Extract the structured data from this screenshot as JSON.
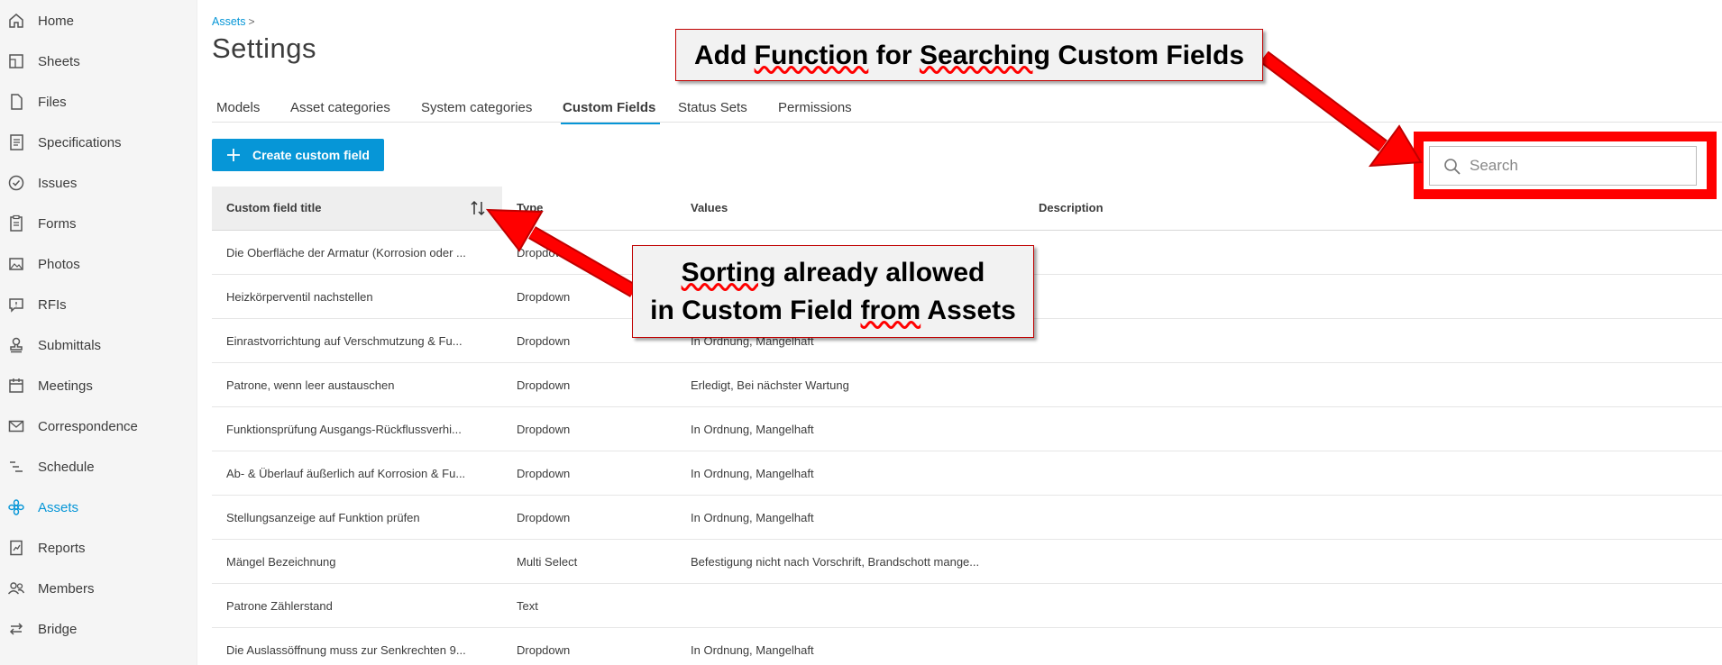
{
  "sidebar": {
    "items": [
      {
        "label": "Home",
        "icon": "home-icon"
      },
      {
        "label": "Sheets",
        "icon": "sheets-icon"
      },
      {
        "label": "Files",
        "icon": "file-icon"
      },
      {
        "label": "Specifications",
        "icon": "specifications-icon"
      },
      {
        "label": "Issues",
        "icon": "check-circle-icon"
      },
      {
        "label": "Forms",
        "icon": "clipboard-icon"
      },
      {
        "label": "Photos",
        "icon": "photo-icon"
      },
      {
        "label": "RFIs",
        "icon": "chat-icon"
      },
      {
        "label": "Submittals",
        "icon": "stamp-icon"
      },
      {
        "label": "Meetings",
        "icon": "calendar-icon"
      },
      {
        "label": "Correspondence",
        "icon": "mail-icon"
      },
      {
        "label": "Schedule",
        "icon": "schedule-icon"
      },
      {
        "label": "Assets",
        "icon": "assets-icon",
        "active": true
      },
      {
        "label": "Reports",
        "icon": "report-icon"
      },
      {
        "label": "Members",
        "icon": "members-icon"
      },
      {
        "label": "Bridge",
        "icon": "bridge-icon"
      }
    ]
  },
  "breadcrumb": {
    "parent": "Assets",
    "separator": ">"
  },
  "page": {
    "title": "Settings"
  },
  "tabs": [
    {
      "label": "Models"
    },
    {
      "label": "Asset categories"
    },
    {
      "label": "System categories"
    },
    {
      "label": "Custom Fields",
      "active": true
    },
    {
      "label": "Status Sets"
    },
    {
      "label": "Permissions"
    }
  ],
  "toolbar": {
    "create_label": "Create custom field"
  },
  "search": {
    "placeholder": "Search",
    "value": ""
  },
  "table": {
    "columns": [
      "Custom field title",
      "Type",
      "Values",
      "Description"
    ],
    "rows": [
      {
        "title": "Die Oberfläche der Armatur (Korrosion oder ...",
        "type": "Dropdown",
        "values": "",
        "description": ""
      },
      {
        "title": "Heizkörperventil nachstellen",
        "type": "Dropdown",
        "values": "",
        "description": ""
      },
      {
        "title": "Einrastvorrichtung auf Verschmutzung & Fu...",
        "type": "Dropdown",
        "values": "In Ordnung, Mangelhaft",
        "description": ""
      },
      {
        "title": "Patrone, wenn leer austauschen",
        "type": "Dropdown",
        "values": "Erledigt, Bei nächster Wartung",
        "description": ""
      },
      {
        "title": "Funktionsprüfung Ausgangs-Rückflussverhi...",
        "type": "Dropdown",
        "values": "In Ordnung, Mangelhaft",
        "description": ""
      },
      {
        "title": "Ab- & Überlauf äußerlich auf Korrosion & Fu...",
        "type": "Dropdown",
        "values": "In Ordnung, Mangelhaft",
        "description": ""
      },
      {
        "title": "Stellungsanzeige auf Funktion prüfen",
        "type": "Dropdown",
        "values": "In Ordnung, Mangelhaft",
        "description": ""
      },
      {
        "title": "Mängel Bezeichnung",
        "type": "Multi Select",
        "values": "Befestigung nicht nach Vorschrift, Brandschott mange...",
        "description": ""
      },
      {
        "title": "Patrone Zählerstand",
        "type": "Text",
        "values": "",
        "description": ""
      },
      {
        "title": "Die Auslassöffnung muss zur Senkrechten 9...",
        "type": "Dropdown",
        "values": "In Ordnung, Mangelhaft",
        "description": ""
      }
    ]
  },
  "annotations": {
    "top": {
      "text_a": "Add ",
      "text_b": "Function",
      "text_c": " for ",
      "text_d": "Searching",
      "text_e": " Custom Fields"
    },
    "middle": {
      "line1_a": "Sorting",
      "line1_b": " already allowed",
      "line2_a": "in Custom Field ",
      "line2_b": "from",
      "line2_c": " Assets"
    }
  },
  "colors": {
    "accent": "#0696d7",
    "annotation_red": "#ff0000",
    "sidebar_bg": "#f5f5f5"
  }
}
